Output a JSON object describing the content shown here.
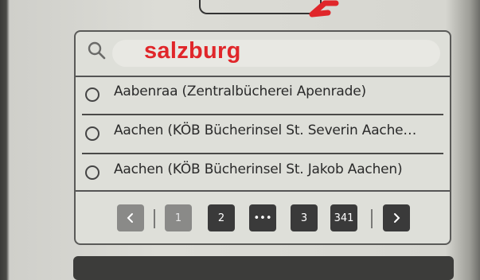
{
  "search": {
    "value": "salzburg"
  },
  "results": [
    {
      "label": "Aabenraa (Zentralbücherei Apenrade)"
    },
    {
      "label": "Aachen (KÖB Bücherinsel St. Severin Aache…"
    },
    {
      "label": "Aachen (KÖB Bücherinsel St. Jakob Aachen)"
    }
  ],
  "pagination": {
    "prev_icon": "chevron-left-icon",
    "next_icon": "chevron-right-icon",
    "pages": [
      "1",
      "2",
      "•••",
      "3",
      "341"
    ],
    "current_page": "1"
  },
  "colors": {
    "search_text": "#e0262a",
    "annotation_arrow": "#e0262a",
    "button_dark": "#3a3a3a",
    "button_disabled": "#8a8a88"
  }
}
